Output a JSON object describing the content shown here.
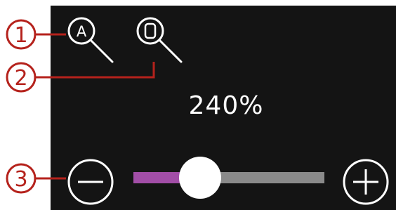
{
  "annotations": {
    "callout_1": "1",
    "callout_2": "2",
    "callout_3": "3"
  },
  "toolbar": {
    "zoom_all_icon_letter": "A",
    "zoom_all_icon": "magnifier-letter-a-icon",
    "zoom_hoop_icon": "magnifier-hoop-icon"
  },
  "zoom": {
    "value_label": "240%",
    "slider_level": 0.35,
    "minus_icon": "minus-circle-icon",
    "plus_icon": "plus-circle-icon"
  },
  "colors": {
    "panel_background": "#141414",
    "icon_stroke": "#ffffff",
    "callout_red": "#b5221c",
    "slider_fill": "#a24ea7",
    "slider_track": "#8a8a8a",
    "slider_thumb": "#ffffff"
  }
}
